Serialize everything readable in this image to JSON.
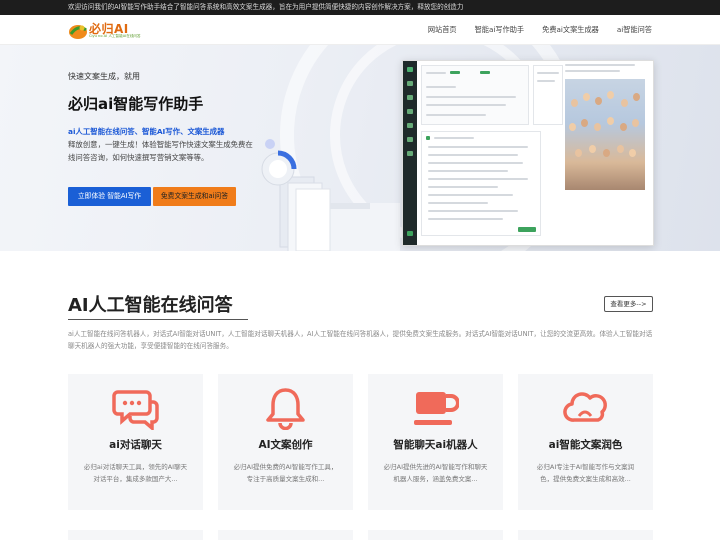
{
  "topbar": {
    "text": "欢迎访问我们的AI智能写作助手结合了智能问答系统和高效文案生成器，旨在为用户提供简便快捷的内容创作解决方案，释放您的创造力"
  },
  "logo": {
    "text": "必归AI",
    "sub": "Ciyu no AI 人工智能AI在线问答"
  },
  "nav": {
    "links": [
      "网站首页",
      "智能ai写作助手",
      "免费ai文案生成器",
      "ai智能问答"
    ]
  },
  "hero": {
    "kicker": "快速文案生成，就用",
    "title": "必归ai智能写作助手",
    "highlight": "ai人工智能在线问答、智能AI写作、文案生成器",
    "desc": "释放创意，一键生成！体验智能写作快速文案生成免费在线问答咨询，如何快速撰写营销文案等等。",
    "btn_primary": "立即体验 智能AI写作",
    "btn_secondary": "免费文案生成和ai问答"
  },
  "section": {
    "title": "AI人工智能在线问答",
    "more": "查看更多-->",
    "desc": "ai人工智能在线问答机器人，对话式AI智能对话UNIT，人工智能对话聊天机器人，AI人工智能在线问答机器人，提供免费文案生成服务。对话式AI智能对话UNIT，让您的交流更高效。体验人工智能对话聊天机器人的强大功能，享受便捷智能的在线问答服务。"
  },
  "cards": [
    {
      "icon": "chat-bubbles-icon",
      "title": "ai对话聊天",
      "text": "必归ai对话聊天工具，领先的AI聊天对话平台，集成多款国产大..."
    },
    {
      "icon": "bell-icon",
      "title": "AI文案创作",
      "text": "必归AI提供免费的AI智能写作工具，专注于高质量文案生成和..."
    },
    {
      "icon": "coffee-cup-icon",
      "title": "智能聊天ai机器人",
      "text": "必归AI提供先进的AI智能写作和聊天机器人服务，涵盖免费文案..."
    },
    {
      "icon": "cloud-icon",
      "title": "ai智能文案润色",
      "text": "必归AI专注于AI智能写作与文案润色，提供免费文案生成和高效..."
    }
  ],
  "colors": {
    "accent": "#f06a5a",
    "primary": "#1a5fd6",
    "orange": "#f07c1a"
  }
}
